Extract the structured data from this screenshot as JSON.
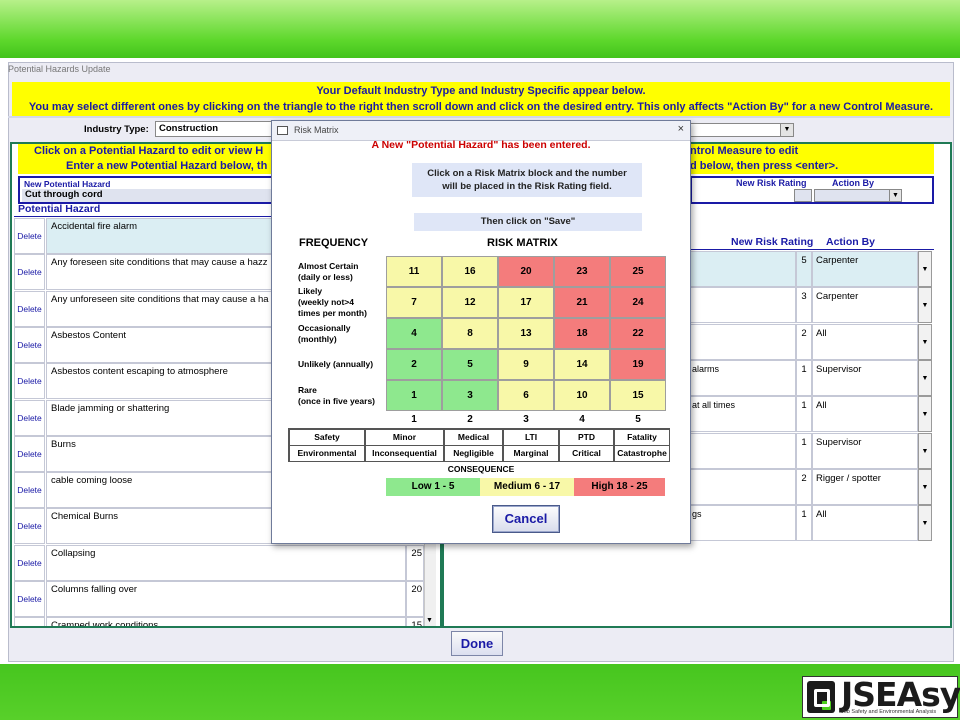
{
  "window_title": "Potential Hazards Update",
  "banner": {
    "line1": "Your Default Industry Type and Industry Specific appear below.",
    "line2": "You may select different ones by clicking on the triangle to the right then scroll down  and click on the desired entry.  This only affects \"Action By\" for a new Control Measure."
  },
  "industry": {
    "label": "Industry Type:",
    "value": "Construction"
  },
  "left_instructions": {
    "line1": "Click on a Potential Hazard to edit or view H",
    "line2": "Enter a new Potential Hazard below, th"
  },
  "new_hazard": {
    "label": "New Potential Hazard",
    "value": "Cut through cord"
  },
  "hazard_list_header": "Potential Hazard",
  "hazards": [
    {
      "delete": "Delete",
      "text": "Accidental fire alarm",
      "rating": ""
    },
    {
      "delete": "Delete",
      "text": "Any foreseen site conditions that may cause a hazz",
      "rating": ""
    },
    {
      "delete": "Delete",
      "text": "Any unforeseen site conditions that may cause a ha",
      "rating": ""
    },
    {
      "delete": "Delete",
      "text": "Asbestos Content",
      "rating": ""
    },
    {
      "delete": "Delete",
      "text": "Asbestos content escaping to atmosphere",
      "rating": ""
    },
    {
      "delete": "Delete",
      "text": "Blade jamming or shattering",
      "rating": ""
    },
    {
      "delete": "Delete",
      "text": "Burns",
      "rating": ""
    },
    {
      "delete": "Delete",
      "text": "cable coming loose",
      "rating": ""
    },
    {
      "delete": "Delete",
      "text": "Chemical Burns",
      "rating": ""
    },
    {
      "delete": "Delete",
      "text": "Collapsing",
      "rating": "25"
    },
    {
      "delete": "Delete",
      "text": "Columns falling over",
      "rating": "20"
    },
    {
      "delete": "Delete",
      "text": "Cramped work conditions",
      "rating": "15"
    }
  ],
  "right_instructions": {
    "line1": "ntrol Measure to edit",
    "line2": "d below, then press <enter>."
  },
  "right_new": {
    "rating_label": "New Risk Rating",
    "action_label": "Action By"
  },
  "right_headers": {
    "rating": "New Risk Rating",
    "action": "Action By"
  },
  "controls": [
    {
      "text": "",
      "rating": "5",
      "action": "Carpenter"
    },
    {
      "text": "",
      "rating": "3",
      "action": "Carpenter"
    },
    {
      "text": "",
      "rating": "2",
      "action": "All"
    },
    {
      "text": "alarms",
      "rating": "1",
      "action": "Supervisor"
    },
    {
      "text": "at all times",
      "rating": "1",
      "action": "All"
    },
    {
      "text": "",
      "rating": "1",
      "action": "Supervisor"
    },
    {
      "text": "",
      "rating": "2",
      "action": "Rigger / spotter"
    },
    {
      "text": "gs",
      "rating": "1",
      "action": "All"
    }
  ],
  "done_label": "Done",
  "logo": {
    "name": "JSEAsy",
    "subtitle": "Job Safety and Environmental Analysis"
  },
  "dialog": {
    "title": "Risk Matrix",
    "close": "×",
    "message": "A New \"Potential Hazard\" has been entered.",
    "instruction1": "Click on a Risk Matrix block and the number",
    "instruction2": "will be placed in the Risk Rating field.",
    "instruction3": "Then click on \"Save\"",
    "frequency_label": "FREQUENCY",
    "matrix_label": "RISK MATRIX",
    "frequencies": [
      {
        "l1": "Almost Certain",
        "l2": "(daily or less)",
        "l3": ""
      },
      {
        "l1": "Likely",
        "l2": "(weekly not>4",
        "l3": "times per month)"
      },
      {
        "l1": "Occasionally",
        "l2": "(monthly)",
        "l3": ""
      },
      {
        "l1": "Unlikely (annually)",
        "l2": "",
        "l3": ""
      },
      {
        "l1": "Rare",
        "l2": "(once in five years)",
        "l3": ""
      }
    ],
    "matrix": [
      [
        "11",
        "16",
        "20",
        "23",
        "25"
      ],
      [
        "7",
        "12",
        "17",
        "21",
        "24"
      ],
      [
        "4",
        "8",
        "13",
        "18",
        "22"
      ],
      [
        "2",
        "5",
        "9",
        "14",
        "19"
      ],
      [
        "1",
        "3",
        "6",
        "10",
        "15"
      ]
    ],
    "colors": {
      "low": "#8ee88e",
      "medium": "#f8f8a8",
      "high": "#f47c7c"
    },
    "columns": [
      "1",
      "2",
      "3",
      "4",
      "5"
    ],
    "consequence_row1": [
      "Safety",
      "Minor",
      "Medical",
      "LTI",
      "PTD",
      "Fatality"
    ],
    "consequence_row2": [
      "Environmental",
      "Inconsequential",
      "Negligible",
      "Marginal",
      "Critical",
      "Catastrophe"
    ],
    "consequence_label": "CONSEQUENCE",
    "legend": {
      "low": "Low 1 - 5",
      "medium": "Medium 6 - 17",
      "high": "High 18 - 25"
    },
    "cancel": "Cancel"
  }
}
